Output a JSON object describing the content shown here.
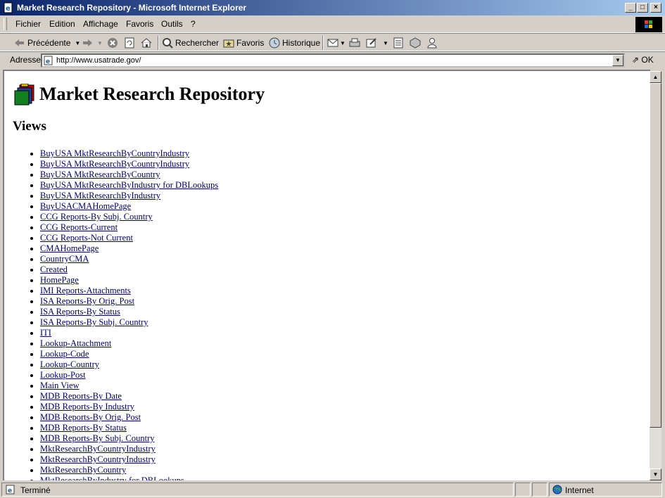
{
  "window": {
    "title": "Market Research Repository - Microsoft Internet Explorer"
  },
  "menu": [
    "Fichier",
    "Edition",
    "Affichage",
    "Favoris",
    "Outils",
    "?"
  ],
  "toolbar": {
    "back": "Précédente",
    "search": "Rechercher",
    "favorites": "Favoris",
    "history": "Historique"
  },
  "address": {
    "label": "Adresse",
    "url": "http://www.usatrade.gov/",
    "go": "OK"
  },
  "page": {
    "title": "Market Research Repository",
    "views_heading": "Views",
    "views": [
      "BuyUSA MktResearchByCountryIndustry",
      "BuyUSA MktResearchByCountryIndustry",
      "BuyUSA MktResearchByCountry",
      "BuyUSA MktResearchByIndustry for DBLookups",
      "BuyUSA MktResearchByIndustry",
      "BuyUSACMAHomePage",
      "CCG Reports-By Subj. Country",
      "CCG Reports-Current",
      "CCG Reports-Not Current",
      "CMAHomePage",
      "CountryCMA",
      "Created",
      "HomePage",
      "IMI Reports-Attachments",
      "ISA Reports-By Orig. Post",
      "ISA Reports-By Status",
      "ISA Reports-By Subj. Country",
      "ITI",
      "Lookup-Attachment",
      "Lookup-Code",
      "Lookup-Country",
      "Lookup-Post",
      "Main View",
      "MDB Reports-By Date",
      "MDB Reports-By Industry",
      "MDB Reports-By Orig. Post",
      "MDB Reports-By Status",
      "MDB Reports-By Subj. Country",
      "MktResearchByCountryIndustry",
      "MktResearchByCountryIndustry",
      "MktResearchByCountry",
      "MktResearchByIndustry for DBLookups"
    ]
  },
  "status": {
    "text": "Terminé",
    "zone": "Internet"
  }
}
